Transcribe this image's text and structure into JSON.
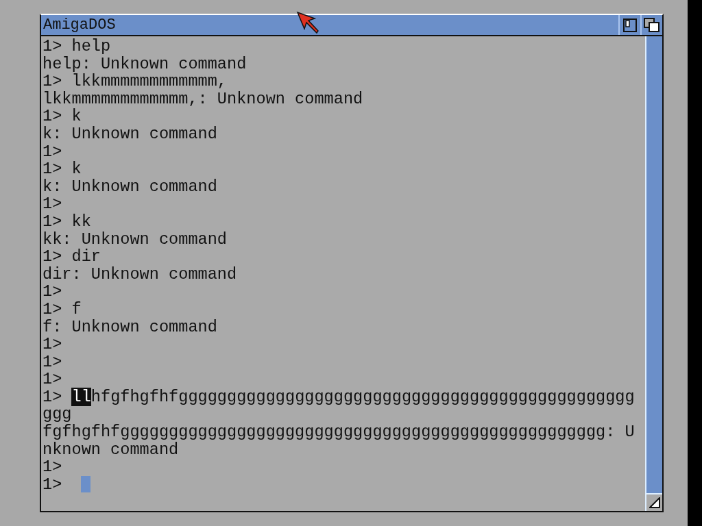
{
  "window": {
    "title": "AmigaDOS"
  },
  "console": {
    "lines": [
      {
        "text": "1> help"
      },
      {
        "text": "help: Unknown command"
      },
      {
        "text": "1> lkkmmmmmmmmmmmm,"
      },
      {
        "text": "lkkmmmmmmmmmmmm,: Unknown command"
      },
      {
        "text": "1> k"
      },
      {
        "text": "k: Unknown command"
      },
      {
        "text": "1>"
      },
      {
        "text": "1> k"
      },
      {
        "text": "k: Unknown command"
      },
      {
        "text": "1>"
      },
      {
        "text": "1> kk"
      },
      {
        "text": "kk: Unknown command"
      },
      {
        "text": "1> dir"
      },
      {
        "text": "dir: Unknown command"
      },
      {
        "text": "1>"
      },
      {
        "text": "1> f"
      },
      {
        "text": "f: Unknown command"
      },
      {
        "text": "1>"
      },
      {
        "text": "1>"
      },
      {
        "text": "1>"
      },
      {
        "segments": [
          {
            "text": "1> ",
            "highlighted": false
          },
          {
            "text": "ll",
            "highlighted": true
          },
          {
            "text": "hfgfhgfhfggggggggggggggggggggggggggggggggggggggggggggggg",
            "highlighted": false
          }
        ]
      },
      {
        "text": "ggg"
      },
      {
        "text": "fgfhgfhfgggggggggggggggggggggggggggggggggggggggggggggggggg: U"
      },
      {
        "text": "nknown command"
      },
      {
        "text": "1>"
      },
      {
        "text": "1>",
        "cursor": true
      }
    ]
  }
}
